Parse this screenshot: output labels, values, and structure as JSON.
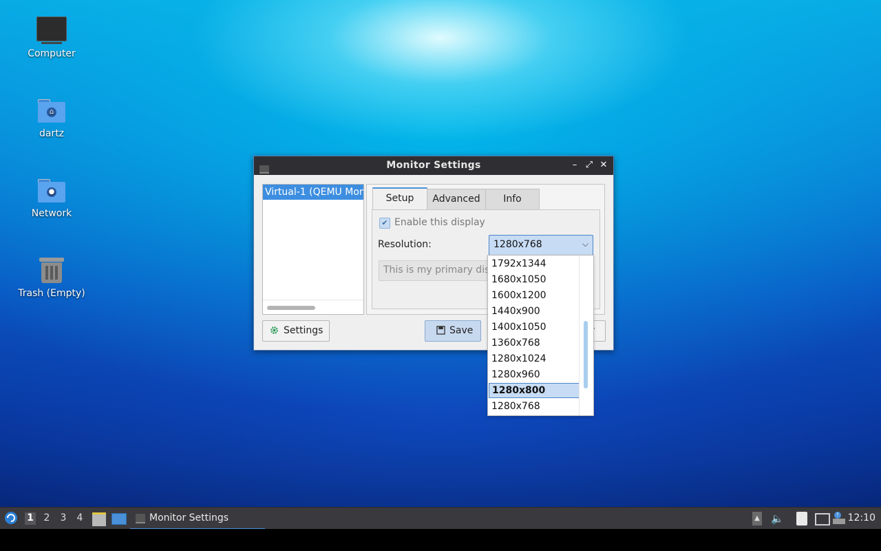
{
  "desktop": {
    "icons": [
      {
        "label": "Computer",
        "icon": "monitor-icon"
      },
      {
        "label": "dartz",
        "icon": "home-folder-icon"
      },
      {
        "label": "Network",
        "icon": "network-folder-icon"
      },
      {
        "label": "Trash (Empty)",
        "icon": "trash-icon"
      }
    ]
  },
  "window": {
    "title": "Monitor Settings",
    "monitor_list": [
      "Virtual-1 (QEMU Mon"
    ],
    "tabs": [
      "Setup",
      "Advanced",
      "Info"
    ],
    "active_tab": "Setup",
    "enable_display_label": "Enable this display",
    "enable_display_checked": true,
    "resolution_label": "Resolution:",
    "resolution_value": "1280x768",
    "primary_display_text": "This is my primary disp",
    "settings_button": "Settings",
    "save_button": "Save",
    "apply_button_partial": "y"
  },
  "resolution_dropdown": {
    "options": [
      "1792x1344",
      "1680x1050",
      "1600x1200",
      "1440x900",
      "1400x1050",
      "1360x768",
      "1280x1024",
      "1280x960",
      "1280x800",
      "1280x768"
    ],
    "highlighted": "1280x800"
  },
  "taskbar": {
    "workspaces": [
      "1",
      "2",
      "3",
      "4"
    ],
    "current_workspace": "1",
    "task_label": "Monitor Settings",
    "clock": "12:10"
  },
  "colors": {
    "accent": "#4a90d9",
    "selection": "#3d8ee0",
    "titlebar": "#2f2f33",
    "taskbar": "#3a3a3e"
  }
}
